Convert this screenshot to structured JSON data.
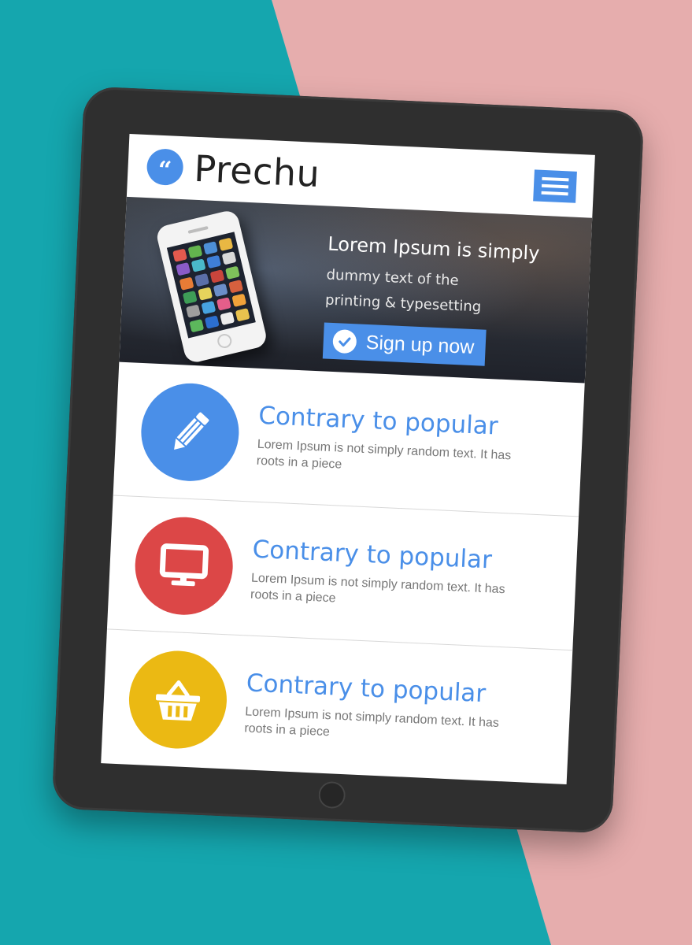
{
  "header": {
    "logo_glyph": "“",
    "brand": "Prechu",
    "menu_icon": "hamburger-icon"
  },
  "hero": {
    "title": "Lorem Ipsum is simply",
    "line1": "dummy text of the",
    "line2": "printing & typesetting",
    "cta_label": "Sign up now",
    "cta_icon": "check-circle-icon"
  },
  "features": [
    {
      "icon": "pencil-icon",
      "color": "#4a8fe8",
      "title": "Contrary to popular",
      "desc": "Lorem Ipsum is not simply random text. It has roots in a piece"
    },
    {
      "icon": "monitor-icon",
      "color": "#dc4747",
      "title": "Contrary to popular",
      "desc": "Lorem Ipsum is not simply random text. It has roots in a piece"
    },
    {
      "icon": "basket-icon",
      "color": "#ebb913",
      "title": "Contrary to popular",
      "desc": "Lorem Ipsum is not simply random text. It has roots in a piece"
    }
  ],
  "colors": {
    "accent": "#4a8fe8",
    "background_teal": "#15a6ae",
    "background_pink": "#e6adad",
    "device": "#2f2f2f"
  }
}
